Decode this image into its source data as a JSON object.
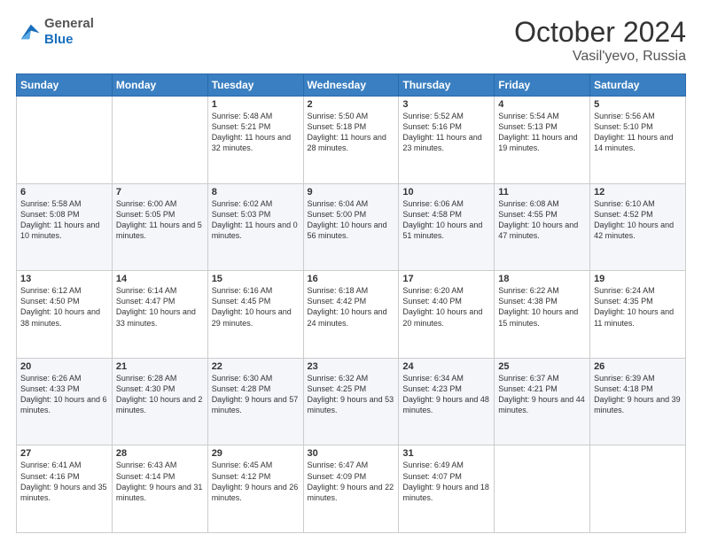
{
  "header": {
    "logo_line1": "General",
    "logo_line2": "Blue",
    "month": "October 2024",
    "location": "Vasil'yevo, Russia"
  },
  "weekdays": [
    "Sunday",
    "Monday",
    "Tuesday",
    "Wednesday",
    "Thursday",
    "Friday",
    "Saturday"
  ],
  "weeks": [
    [
      {
        "day": "",
        "info": ""
      },
      {
        "day": "",
        "info": ""
      },
      {
        "day": "1",
        "info": "Sunrise: 5:48 AM\nSunset: 5:21 PM\nDaylight: 11 hours and 32 minutes."
      },
      {
        "day": "2",
        "info": "Sunrise: 5:50 AM\nSunset: 5:18 PM\nDaylight: 11 hours and 28 minutes."
      },
      {
        "day": "3",
        "info": "Sunrise: 5:52 AM\nSunset: 5:16 PM\nDaylight: 11 hours and 23 minutes."
      },
      {
        "day": "4",
        "info": "Sunrise: 5:54 AM\nSunset: 5:13 PM\nDaylight: 11 hours and 19 minutes."
      },
      {
        "day": "5",
        "info": "Sunrise: 5:56 AM\nSunset: 5:10 PM\nDaylight: 11 hours and 14 minutes."
      }
    ],
    [
      {
        "day": "6",
        "info": "Sunrise: 5:58 AM\nSunset: 5:08 PM\nDaylight: 11 hours and 10 minutes."
      },
      {
        "day": "7",
        "info": "Sunrise: 6:00 AM\nSunset: 5:05 PM\nDaylight: 11 hours and 5 minutes."
      },
      {
        "day": "8",
        "info": "Sunrise: 6:02 AM\nSunset: 5:03 PM\nDaylight: 11 hours and 0 minutes."
      },
      {
        "day": "9",
        "info": "Sunrise: 6:04 AM\nSunset: 5:00 PM\nDaylight: 10 hours and 56 minutes."
      },
      {
        "day": "10",
        "info": "Sunrise: 6:06 AM\nSunset: 4:58 PM\nDaylight: 10 hours and 51 minutes."
      },
      {
        "day": "11",
        "info": "Sunrise: 6:08 AM\nSunset: 4:55 PM\nDaylight: 10 hours and 47 minutes."
      },
      {
        "day": "12",
        "info": "Sunrise: 6:10 AM\nSunset: 4:52 PM\nDaylight: 10 hours and 42 minutes."
      }
    ],
    [
      {
        "day": "13",
        "info": "Sunrise: 6:12 AM\nSunset: 4:50 PM\nDaylight: 10 hours and 38 minutes."
      },
      {
        "day": "14",
        "info": "Sunrise: 6:14 AM\nSunset: 4:47 PM\nDaylight: 10 hours and 33 minutes."
      },
      {
        "day": "15",
        "info": "Sunrise: 6:16 AM\nSunset: 4:45 PM\nDaylight: 10 hours and 29 minutes."
      },
      {
        "day": "16",
        "info": "Sunrise: 6:18 AM\nSunset: 4:42 PM\nDaylight: 10 hours and 24 minutes."
      },
      {
        "day": "17",
        "info": "Sunrise: 6:20 AM\nSunset: 4:40 PM\nDaylight: 10 hours and 20 minutes."
      },
      {
        "day": "18",
        "info": "Sunrise: 6:22 AM\nSunset: 4:38 PM\nDaylight: 10 hours and 15 minutes."
      },
      {
        "day": "19",
        "info": "Sunrise: 6:24 AM\nSunset: 4:35 PM\nDaylight: 10 hours and 11 minutes."
      }
    ],
    [
      {
        "day": "20",
        "info": "Sunrise: 6:26 AM\nSunset: 4:33 PM\nDaylight: 10 hours and 6 minutes."
      },
      {
        "day": "21",
        "info": "Sunrise: 6:28 AM\nSunset: 4:30 PM\nDaylight: 10 hours and 2 minutes."
      },
      {
        "day": "22",
        "info": "Sunrise: 6:30 AM\nSunset: 4:28 PM\nDaylight: 9 hours and 57 minutes."
      },
      {
        "day": "23",
        "info": "Sunrise: 6:32 AM\nSunset: 4:25 PM\nDaylight: 9 hours and 53 minutes."
      },
      {
        "day": "24",
        "info": "Sunrise: 6:34 AM\nSunset: 4:23 PM\nDaylight: 9 hours and 48 minutes."
      },
      {
        "day": "25",
        "info": "Sunrise: 6:37 AM\nSunset: 4:21 PM\nDaylight: 9 hours and 44 minutes."
      },
      {
        "day": "26",
        "info": "Sunrise: 6:39 AM\nSunset: 4:18 PM\nDaylight: 9 hours and 39 minutes."
      }
    ],
    [
      {
        "day": "27",
        "info": "Sunrise: 6:41 AM\nSunset: 4:16 PM\nDaylight: 9 hours and 35 minutes."
      },
      {
        "day": "28",
        "info": "Sunrise: 6:43 AM\nSunset: 4:14 PM\nDaylight: 9 hours and 31 minutes."
      },
      {
        "day": "29",
        "info": "Sunrise: 6:45 AM\nSunset: 4:12 PM\nDaylight: 9 hours and 26 minutes."
      },
      {
        "day": "30",
        "info": "Sunrise: 6:47 AM\nSunset: 4:09 PM\nDaylight: 9 hours and 22 minutes."
      },
      {
        "day": "31",
        "info": "Sunrise: 6:49 AM\nSunset: 4:07 PM\nDaylight: 9 hours and 18 minutes."
      },
      {
        "day": "",
        "info": ""
      },
      {
        "day": "",
        "info": ""
      }
    ]
  ]
}
